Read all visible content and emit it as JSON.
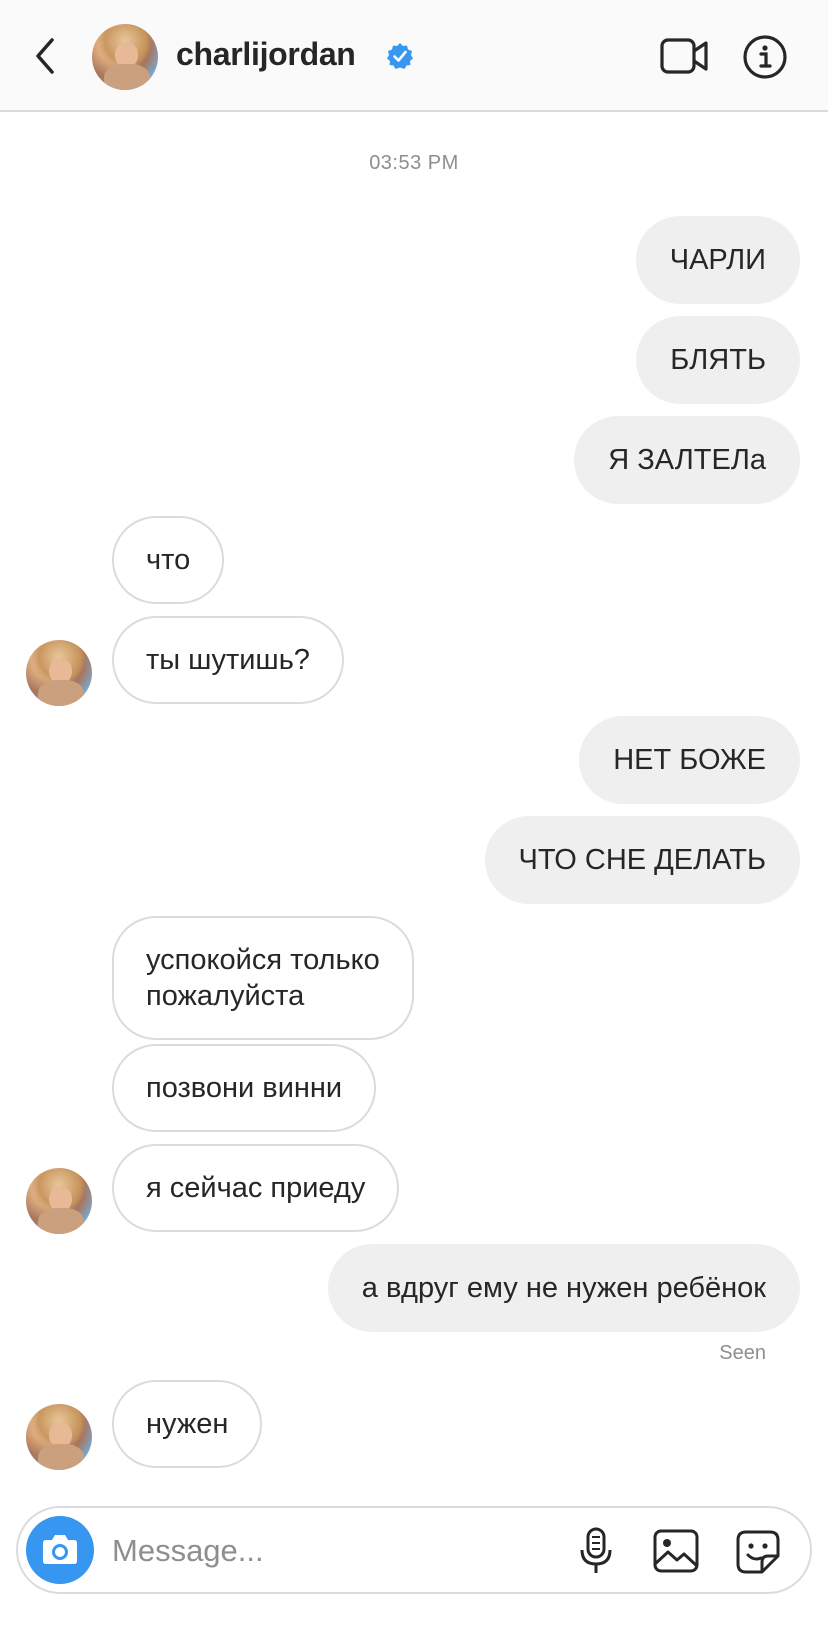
{
  "header": {
    "username": "charlijordan",
    "verified": true,
    "icons": [
      "chevron-left-icon",
      "verified-badge-icon",
      "video-call-icon",
      "info-icon"
    ]
  },
  "chat": {
    "timestamp": "03:53 PM",
    "messages": [
      {
        "side": "out",
        "text": "ЧАРЛИ"
      },
      {
        "side": "out",
        "text": "БЛЯТЬ"
      },
      {
        "side": "out",
        "text": "Я ЗАЛТЕЛа"
      },
      {
        "side": "in",
        "text": "что"
      },
      {
        "side": "in",
        "text": "ты шутишь?"
      },
      {
        "side": "out",
        "text": "НЕТ БОЖЕ"
      },
      {
        "side": "out",
        "text": "ЧТО СНЕ ДЕЛАТЬ"
      },
      {
        "side": "in",
        "text": "успокойся только\nпожалуйста"
      },
      {
        "side": "in",
        "text": "позвони винни"
      },
      {
        "side": "in",
        "text": "я сейчас приеду"
      },
      {
        "side": "out",
        "text": "а вдруг ему не нужен ребёнок"
      },
      {
        "side": "in",
        "text": "нужен"
      }
    ],
    "seen_label": "Seen"
  },
  "composer": {
    "placeholder": "Message...",
    "icons": [
      "camera-icon",
      "microphone-icon",
      "gallery-icon",
      "sticker-icon"
    ]
  },
  "colors": {
    "accent": "#3797f0",
    "verified": "#3897f0",
    "outgoing_bubble": "#efefef",
    "incoming_border": "#dbdbdb",
    "muted_text": "#8e8e8e"
  }
}
